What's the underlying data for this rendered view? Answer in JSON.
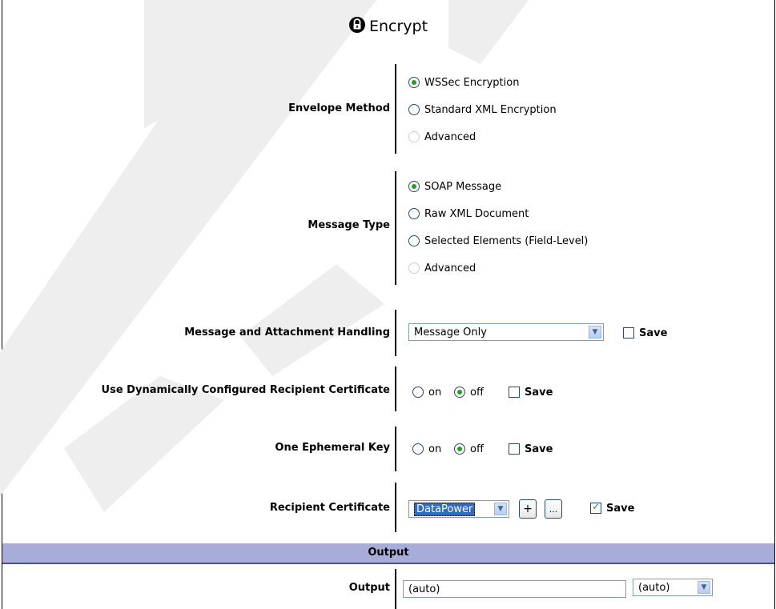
{
  "title": "Encrypt",
  "envelope_method": {
    "label": "Envelope Method",
    "options": [
      {
        "label": "WSSec Encryption",
        "selected": true,
        "disabled": false
      },
      {
        "label": "Standard XML Encryption",
        "selected": false,
        "disabled": false
      },
      {
        "label": "Advanced",
        "selected": false,
        "disabled": true
      }
    ]
  },
  "message_type": {
    "label": "Message Type",
    "options": [
      {
        "label": "SOAP Message",
        "selected": true,
        "disabled": false
      },
      {
        "label": "Raw XML Document",
        "selected": false,
        "disabled": false
      },
      {
        "label": "Selected Elements (Field-Level)",
        "selected": false,
        "disabled": false
      },
      {
        "label": "Advanced",
        "selected": false,
        "disabled": true
      }
    ]
  },
  "attachment_handling": {
    "label": "Message and Attachment Handling",
    "value": "Message Only",
    "save_label": "Save",
    "save_checked": false
  },
  "dynamic_cert": {
    "label": "Use Dynamically Configured Recipient Certificate",
    "on_label": "on",
    "off_label": "off",
    "selected": "off",
    "save_label": "Save",
    "save_checked": false
  },
  "ephemeral_key": {
    "label": "One Ephemeral Key",
    "on_label": "on",
    "off_label": "off",
    "selected": "off",
    "save_label": "Save",
    "save_checked": false
  },
  "recipient_cert": {
    "label": "Recipient Certificate",
    "value": "DataPower",
    "add_label": "+",
    "edit_label": "...",
    "save_label": "Save",
    "save_checked": true
  },
  "output_section": {
    "header": "Output",
    "label": "Output",
    "input_value": "(auto)",
    "select_value": "(auto)"
  },
  "colors": {
    "section_bg": "#a8acd9",
    "radio_selected": "#21a121",
    "highlight": "#316ac5"
  }
}
